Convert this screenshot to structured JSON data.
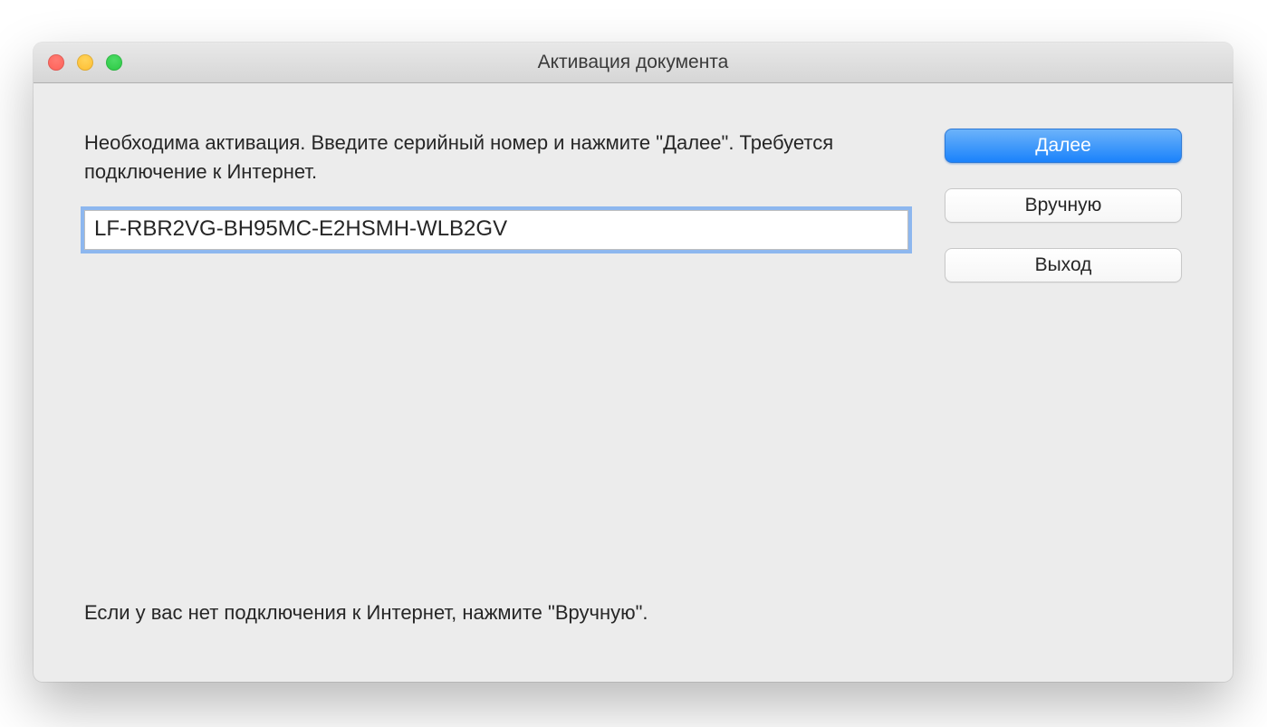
{
  "window": {
    "title": "Активация документа"
  },
  "content": {
    "instructions": "Необходима активация. Введите серийный номер и нажмите \"Далее\". Требуется подключение к Интернет.",
    "serial_value": "LF-RBR2VG-BH95MC-E2HSMH-WLB2GV",
    "footer_note": "Если у вас нет подключения к Интернет, нажмите \"Вручную\"."
  },
  "buttons": {
    "next": "Далее",
    "manual": "Вручную",
    "exit": "Выход"
  }
}
